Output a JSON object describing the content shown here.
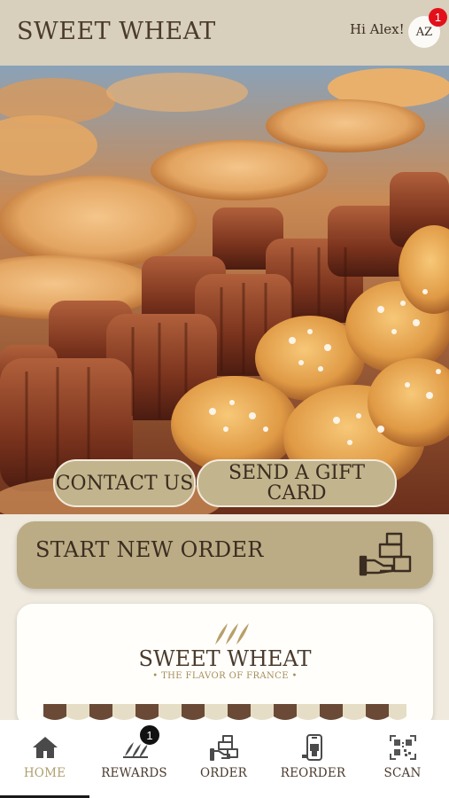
{
  "header": {
    "brand": "SWEET WHEAT",
    "greeting": "Hi Alex!",
    "avatar_initials": "AZ",
    "notification_count": "1"
  },
  "hero": {
    "image_subject": "pastries",
    "contact_label": "CONTACT US",
    "gift_label": "SEND A GIFT CARD"
  },
  "order": {
    "label": "START NEW ORDER",
    "icon": "order-boxes-icon"
  },
  "card": {
    "brand": "SWEET WHEAT",
    "tagline": "• THE FLAVOR OF FRANCE •"
  },
  "nav": {
    "items": [
      {
        "label": "HOME",
        "icon": "home-icon",
        "active": true
      },
      {
        "label": "REWARDS",
        "icon": "rewards-icon",
        "badge": "1"
      },
      {
        "label": "ORDER",
        "icon": "order-icon"
      },
      {
        "label": "REORDER",
        "icon": "reorder-icon"
      },
      {
        "label": "SCAN",
        "icon": "qr-scan-icon"
      }
    ]
  },
  "colors": {
    "header_bg": "#d8cfbc",
    "accent": "#bbac85",
    "badge": "#e3101b",
    "active_tab": "#b09e6e"
  }
}
